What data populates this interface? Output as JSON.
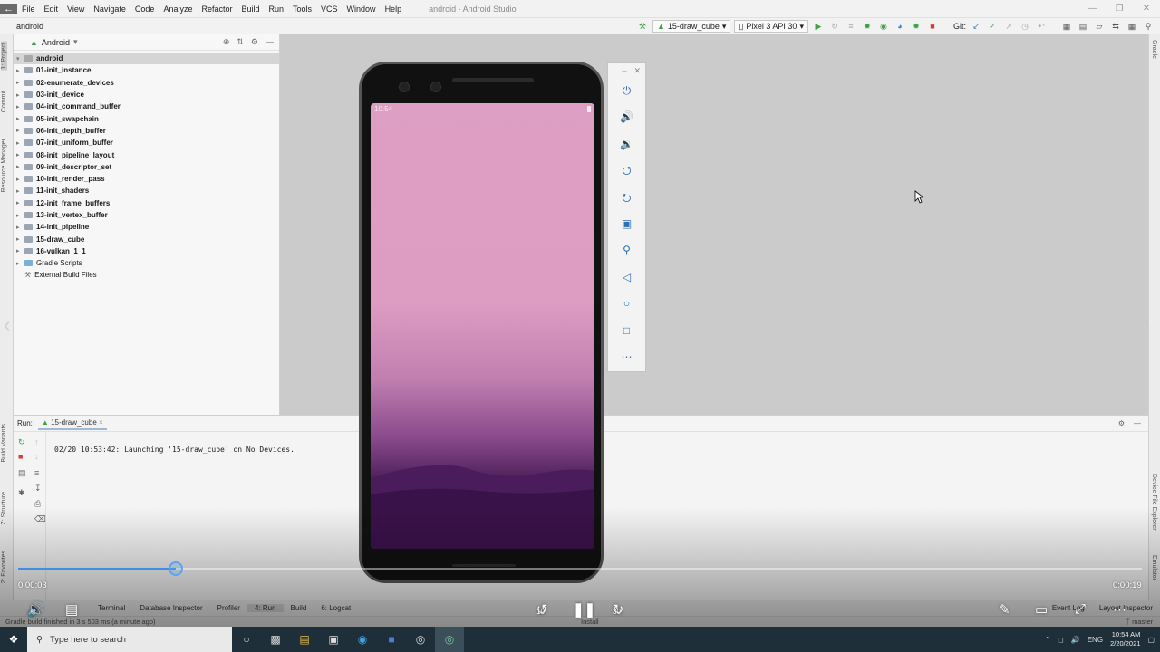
{
  "window": {
    "title": "android - Android Studio",
    "menu": [
      "File",
      "Edit",
      "View",
      "Navigate",
      "Code",
      "Analyze",
      "Refactor",
      "Build",
      "Run",
      "Tools",
      "VCS",
      "Window",
      "Help"
    ]
  },
  "navbar": {
    "breadcrumb": "android",
    "run_config": "15-draw_cube",
    "device": "Pixel 3 API 30",
    "git_label": "Git:"
  },
  "left_strip": {
    "tabs": [
      "1: Project",
      "Commit",
      "Resource Manager",
      "Build Variants",
      "Z: Structure",
      "2: Favorites"
    ]
  },
  "right_strip": {
    "tabs": [
      "Gradle",
      "Device File Explorer",
      "Emulator"
    ]
  },
  "project_panel": {
    "view_selector": "Android",
    "root": "android",
    "items": [
      "01-init_instance",
      "02-enumerate_devices",
      "03-init_device",
      "04-init_command_buffer",
      "05-init_swapchain",
      "06-init_depth_buffer",
      "07-init_uniform_buffer",
      "08-init_pipeline_layout",
      "09-init_descriptor_set",
      "10-init_render_pass",
      "11-init_shaders",
      "12-init_frame_buffers",
      "13-init_vertex_buffer",
      "14-init_pipeline",
      "15-draw_cube",
      "16-vulkan_1_1"
    ],
    "extra": [
      "Gradle Scripts",
      "External Build Files"
    ]
  },
  "emulator": {
    "clock": "10:54",
    "controls": [
      "power-icon",
      "volume-up-icon",
      "volume-down-icon",
      "rotate-left-icon",
      "rotate-right-icon",
      "camera-icon",
      "zoom-icon",
      "back-icon",
      "home-icon",
      "overview-icon",
      "more-icon"
    ]
  },
  "run_panel": {
    "label": "Run:",
    "tab": "15-draw_cube",
    "console": "02/20 10:53:42: Launching '15-draw_cube' on No Devices."
  },
  "bottom_tabs": [
    "Terminal",
    "Database Inspector",
    "Profiler",
    "4: Run",
    "Build",
    "6: Logcat"
  ],
  "bottom_right_tabs": [
    "Event Log",
    "Layout Inspector"
  ],
  "status": {
    "message": "Gradle build finished in 3 s 503 ms (a minute ago)",
    "branch": "master",
    "install": "Install"
  },
  "video": {
    "elapsed": "0:00:03",
    "duration": "0:00:19",
    "progress": 0.14,
    "rewind_label": "10",
    "forward_label": "30"
  },
  "taskbar": {
    "search_placeholder": "Type here to search",
    "lang": "ENG",
    "time": "10:54 AM",
    "date": "2/20/2021"
  },
  "colors": {
    "accent_blue": "#3d8fe6",
    "run_green": "#3ca344",
    "stop_red": "#d63a3a"
  }
}
